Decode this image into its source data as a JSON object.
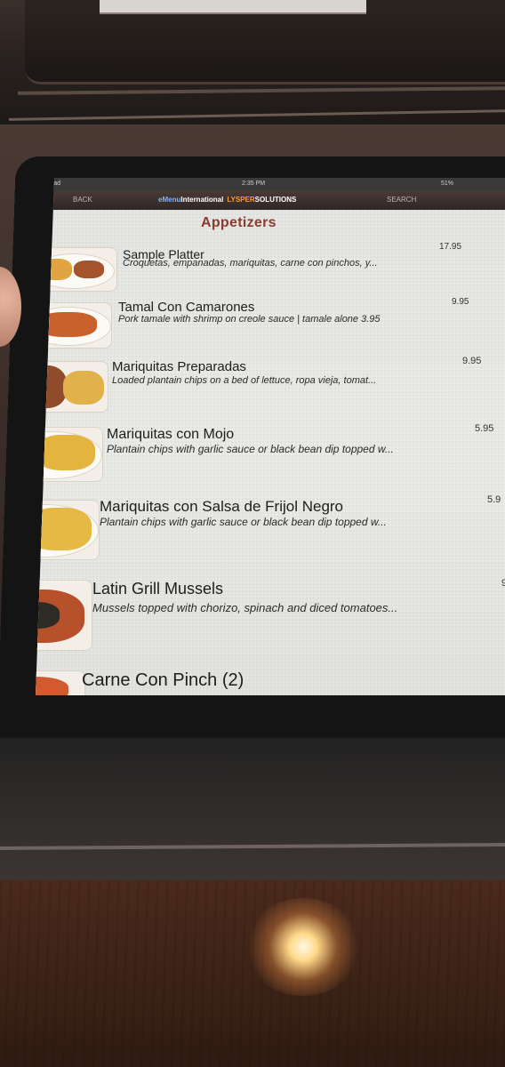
{
  "status_bar": {
    "left": "iPad",
    "time": "2:35 PM",
    "battery": "51%"
  },
  "nav": {
    "back_label": "BACK",
    "search_label": "SEARCH",
    "brand_part1": "eMenu",
    "brand_part2": "International",
    "brand_part3": "LYSPER",
    "brand_part4": "SOLUTIONS"
  },
  "section_title": "Appetizers",
  "items": [
    {
      "name": "Sample Platter",
      "description": "Croquetas, empanadas, mariquitas, carne con pinchos, y...",
      "price": "17.95"
    },
    {
      "name": "Tamal Con Camarones",
      "description": "Pork tamale with shrimp on creole sauce | tamale alone 3.95",
      "price": "9.95"
    },
    {
      "name": "Mariquitas Preparadas",
      "description": "Loaded plantain chips on a bed of lettuce, ropa vieja, tomat...",
      "price": "9.95"
    },
    {
      "name": "Mariquitas con Mojo",
      "description": "Plantain chips with garlic sauce or black bean dip topped w...",
      "price": "5.95"
    },
    {
      "name": "Mariquitas con Salsa de Frijol Negro",
      "description": "Plantain chips with garlic sauce or black bean dip topped w...",
      "price": "5.9"
    },
    {
      "name": "Latin Grill Mussels",
      "description": "Mussels topped with chorizo, spinach and diced tomatoes...",
      "price": "9"
    },
    {
      "name": "Carne Con Pinch (2)",
      "description": "",
      "price": ""
    }
  ],
  "colors": {
    "title_red": "#8a3a2e",
    "nav_brown": "#3a2f2d",
    "brand_orange": "#ff9a33"
  }
}
